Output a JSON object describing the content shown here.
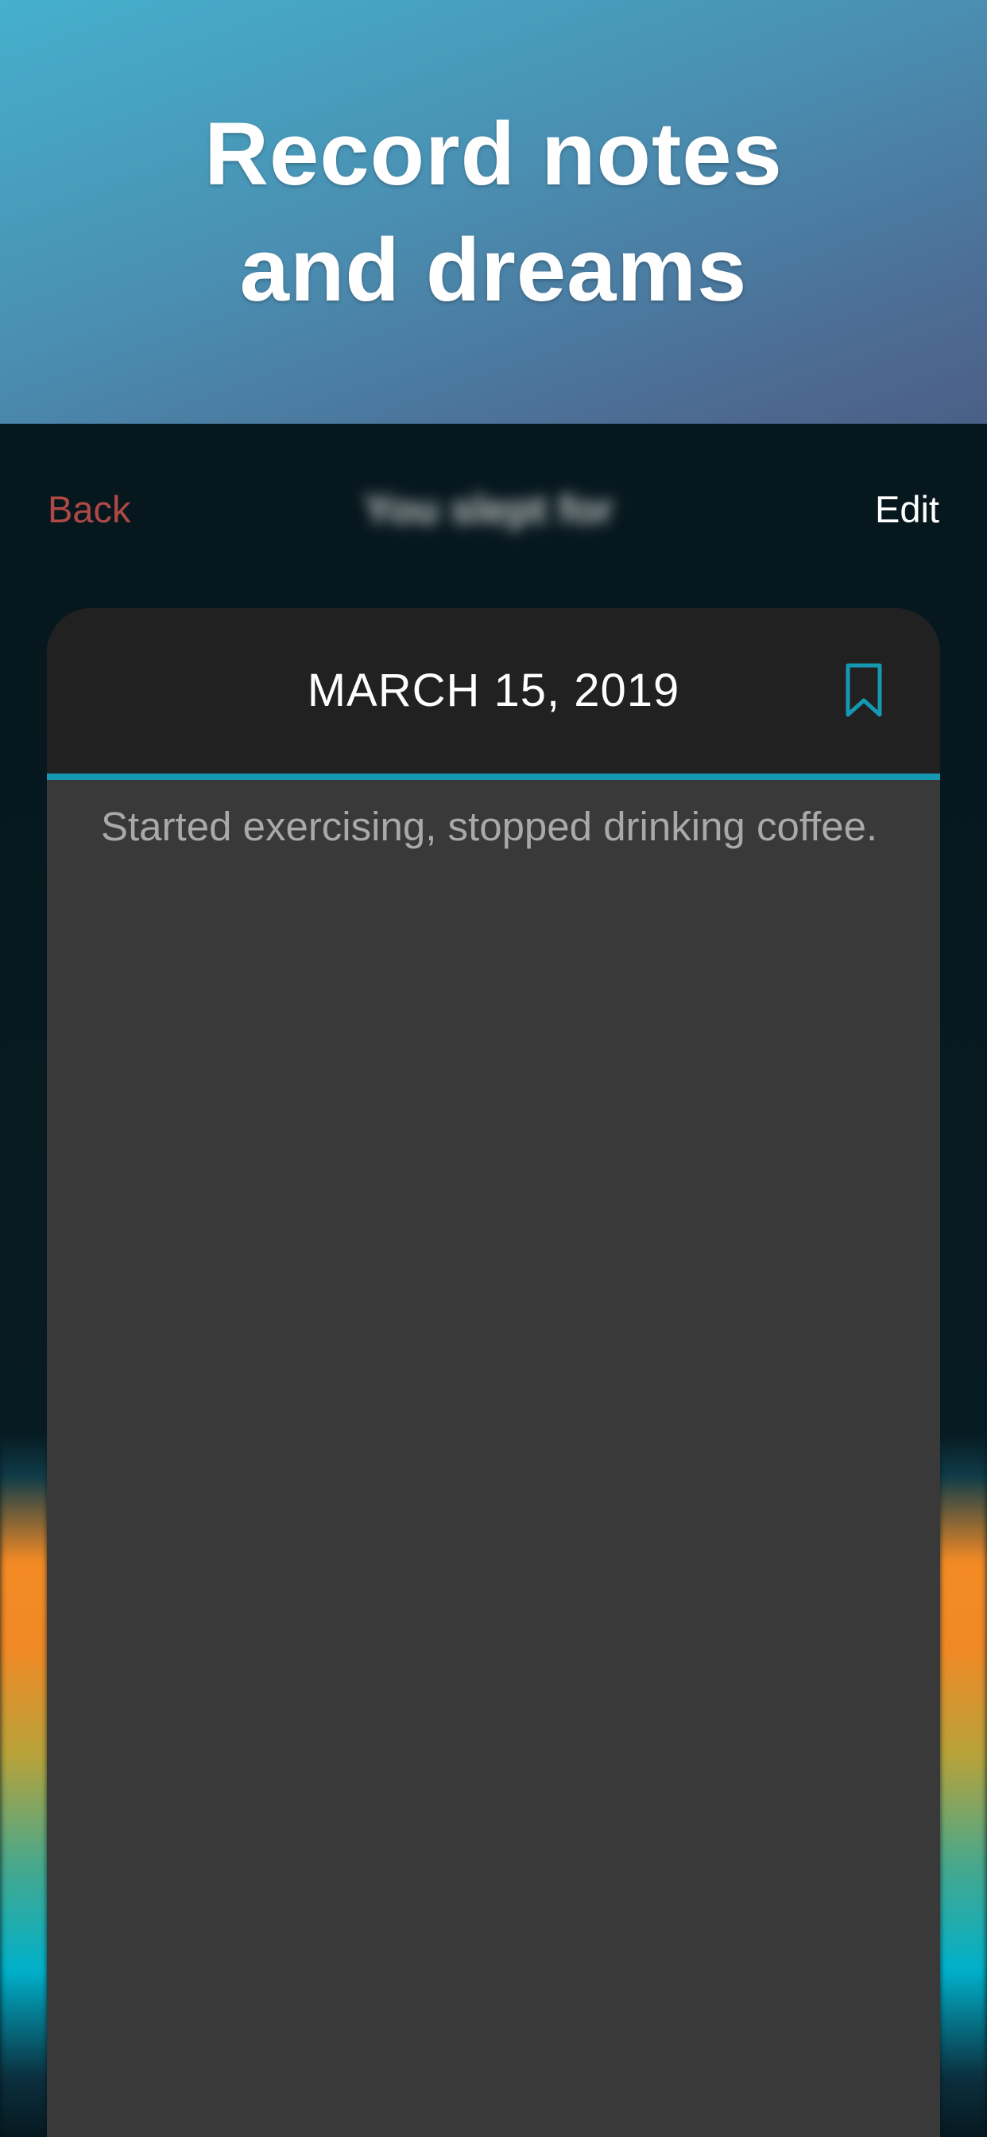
{
  "hero": {
    "title_line1": "Record notes",
    "title_line2": "and dreams"
  },
  "nav": {
    "back_label": "Back",
    "title": "You slept for",
    "edit_label": "Edit"
  },
  "entry": {
    "date": "MARCH 15, 2019",
    "note": "Started exercising, stopped drinking coffee.",
    "bookmark_icon": "bookmark-icon"
  },
  "colors": {
    "back": "#b04846",
    "accent": "#1599b3",
    "card_body": "#393939",
    "card_header": "#212121",
    "background": "#06171d"
  }
}
